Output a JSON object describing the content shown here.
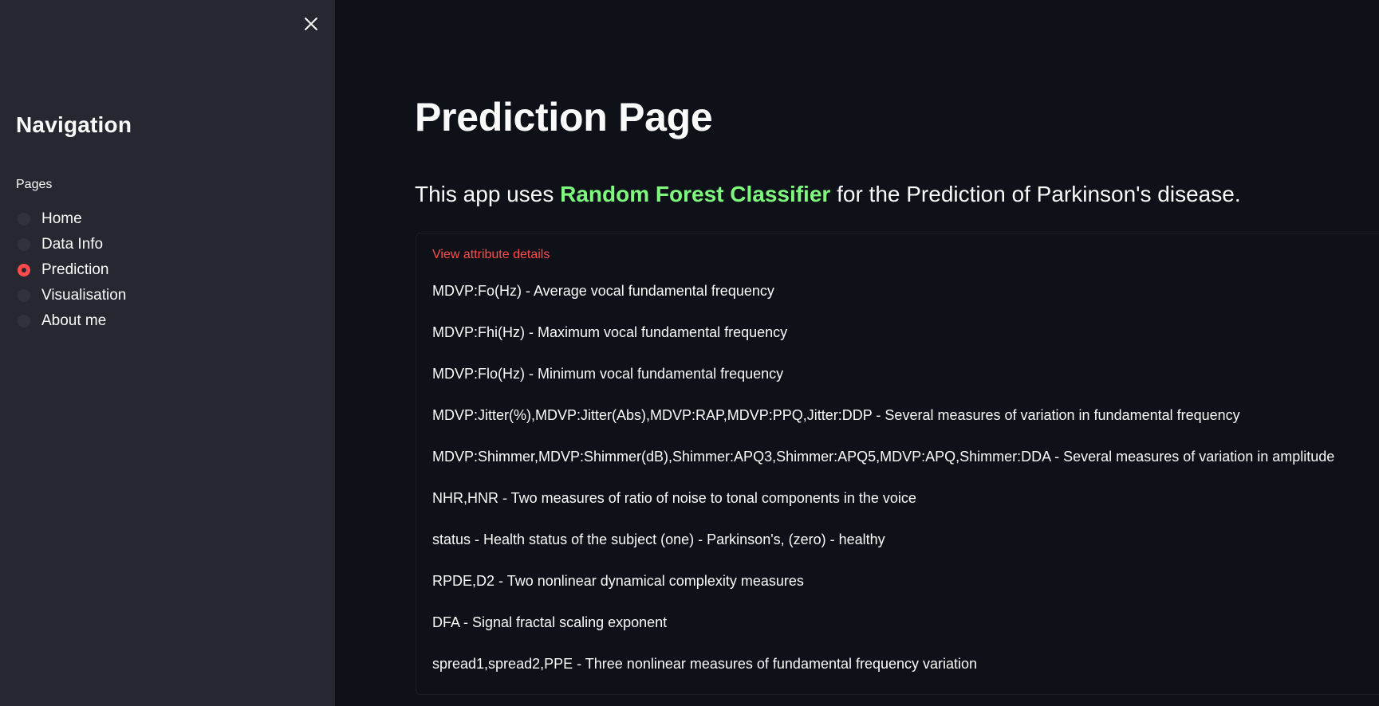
{
  "sidebar": {
    "title": "Navigation",
    "radio_label": "Pages",
    "items": [
      {
        "label": "Home",
        "selected": false
      },
      {
        "label": "Data Info",
        "selected": false
      },
      {
        "label": "Prediction",
        "selected": true
      },
      {
        "label": "Visualisation",
        "selected": false
      },
      {
        "label": "About me",
        "selected": false
      }
    ],
    "close_icon": "close-icon"
  },
  "main": {
    "title": "Prediction Page",
    "intro": {
      "before": "This app uses ",
      "highlight": "Random Forest Classifier",
      "after": " for the Prediction of Parkinson's disease."
    },
    "expander": {
      "label": "View attribute details",
      "attributes": [
        "MDVP:Fo(Hz) - Average vocal fundamental frequency",
        "MDVP:Fhi(Hz) - Maximum vocal fundamental frequency",
        "MDVP:Flo(Hz) - Minimum vocal fundamental frequency",
        "MDVP:Jitter(%),MDVP:Jitter(Abs),MDVP:RAP,MDVP:PPQ,Jitter:DDP - Several measures of variation in fundamental frequency",
        "MDVP:Shimmer,MDVP:Shimmer(dB),Shimmer:APQ3,Shimmer:APQ5,MDVP:APQ,Shimmer:DDA - Several measures of variation in amplitude",
        "NHR,HNR - Two measures of ratio of noise to tonal components in the voice",
        "status - Health status of the subject (one) - Parkinson's, (zero) - healthy",
        "RPDE,D2 - Two nonlinear dynamical complexity measures",
        "DFA - Signal fractal scaling exponent",
        "spread1,spread2,PPE - Three nonlinear measures of fundamental frequency variation"
      ]
    }
  },
  "colors": {
    "sidebar_bg": "#262730",
    "main_bg": "#0e1117",
    "accent": "#ff4b4b",
    "highlight_green": "#7ef97e",
    "text": "#fafafa"
  }
}
